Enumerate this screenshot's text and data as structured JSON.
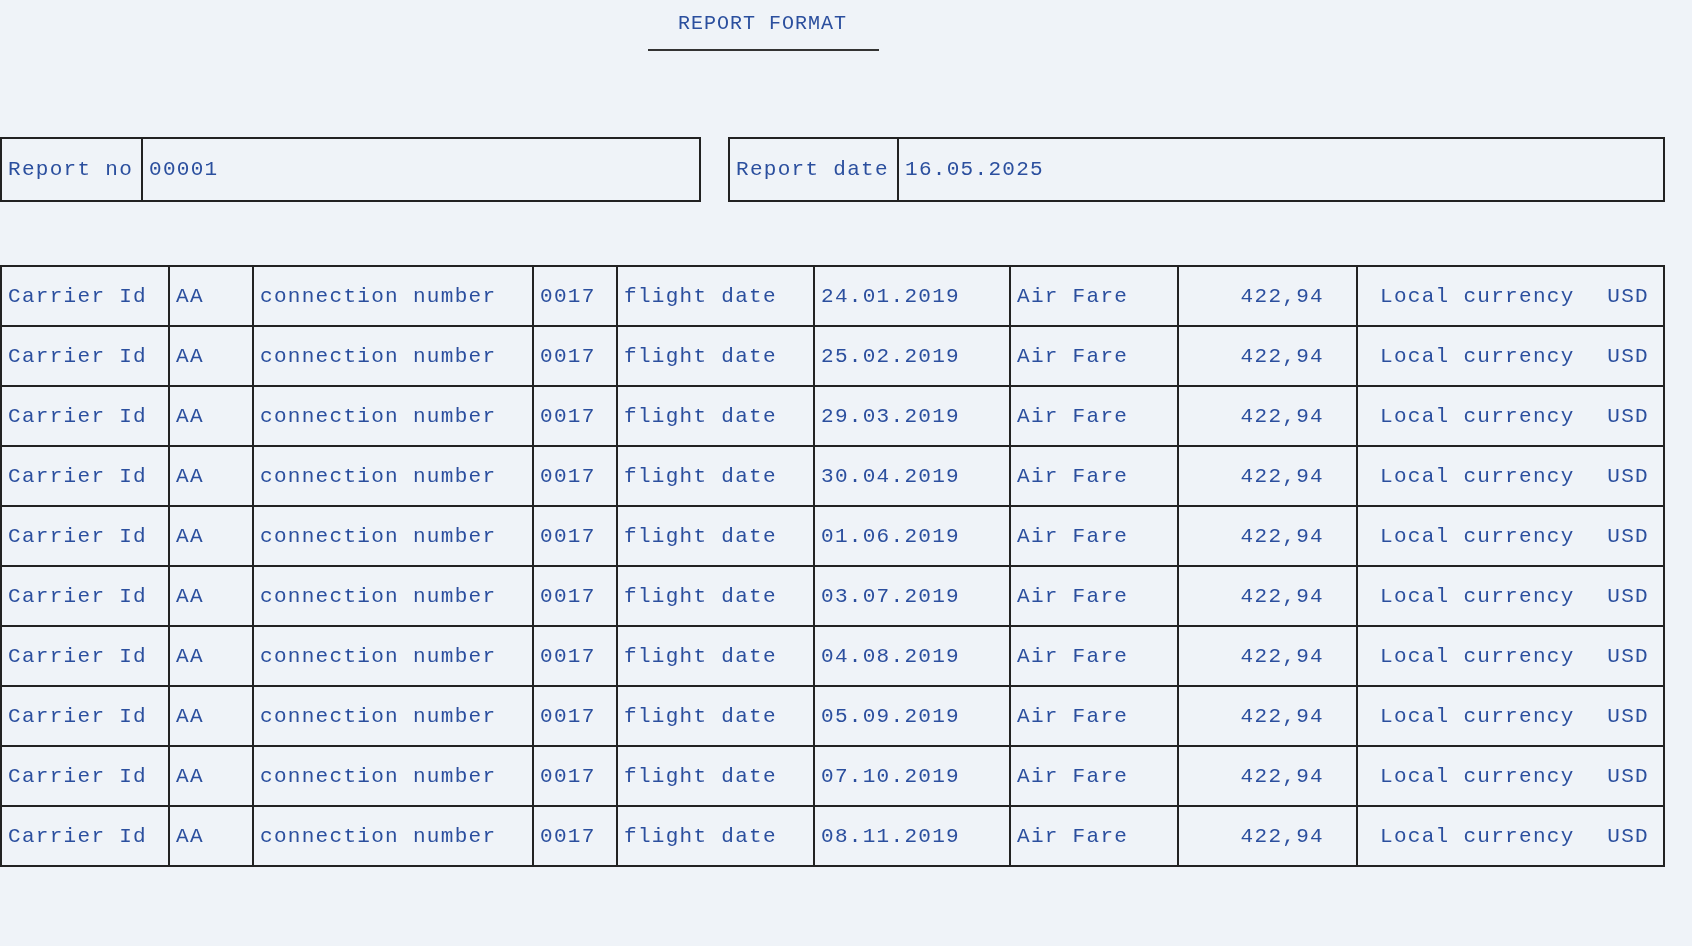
{
  "title": "REPORT FORMAT",
  "header": [
    {
      "label": "Report no",
      "value": "00001"
    },
    {
      "label": "Report date",
      "value": "16.05.2025"
    }
  ],
  "rows": [
    {
      "carrier_label": "Carrier Id",
      "carrier": "AA",
      "connection_label": "connection number",
      "connection": "0017",
      "date_label": "flight date",
      "date": "24.01.2019",
      "fare_label": "Air Fare",
      "fare": "422,94",
      "currency_label": "Local currency",
      "currency": "USD"
    },
    {
      "carrier_label": "Carrier Id",
      "carrier": "AA",
      "connection_label": "connection number",
      "connection": "0017",
      "date_label": "flight date",
      "date": "25.02.2019",
      "fare_label": "Air Fare",
      "fare": "422,94",
      "currency_label": "Local currency",
      "currency": "USD"
    },
    {
      "carrier_label": "Carrier Id",
      "carrier": "AA",
      "connection_label": "connection number",
      "connection": "0017",
      "date_label": "flight date",
      "date": "29.03.2019",
      "fare_label": "Air Fare",
      "fare": "422,94",
      "currency_label": "Local currency",
      "currency": "USD"
    },
    {
      "carrier_label": "Carrier Id",
      "carrier": "AA",
      "connection_label": "connection number",
      "connection": "0017",
      "date_label": "flight date",
      "date": "30.04.2019",
      "fare_label": "Air Fare",
      "fare": "422,94",
      "currency_label": "Local currency",
      "currency": "USD"
    },
    {
      "carrier_label": "Carrier Id",
      "carrier": "AA",
      "connection_label": "connection number",
      "connection": "0017",
      "date_label": "flight date",
      "date": "01.06.2019",
      "fare_label": "Air Fare",
      "fare": "422,94",
      "currency_label": "Local currency",
      "currency": "USD"
    },
    {
      "carrier_label": "Carrier Id",
      "carrier": "AA",
      "connection_label": "connection number",
      "connection": "0017",
      "date_label": "flight date",
      "date": "03.07.2019",
      "fare_label": "Air Fare",
      "fare": "422,94",
      "currency_label": "Local currency",
      "currency": "USD"
    },
    {
      "carrier_label": "Carrier Id",
      "carrier": "AA",
      "connection_label": "connection number",
      "connection": "0017",
      "date_label": "flight date",
      "date": "04.08.2019",
      "fare_label": "Air Fare",
      "fare": "422,94",
      "currency_label": "Local currency",
      "currency": "USD"
    },
    {
      "carrier_label": "Carrier Id",
      "carrier": "AA",
      "connection_label": "connection number",
      "connection": "0017",
      "date_label": "flight date",
      "date": "05.09.2019",
      "fare_label": "Air Fare",
      "fare": "422,94",
      "currency_label": "Local currency",
      "currency": "USD"
    },
    {
      "carrier_label": "Carrier Id",
      "carrier": "AA",
      "connection_label": "connection number",
      "connection": "0017",
      "date_label": "flight date",
      "date": "07.10.2019",
      "fare_label": "Air Fare",
      "fare": "422,94",
      "currency_label": "Local currency",
      "currency": "USD"
    },
    {
      "carrier_label": "Carrier Id",
      "carrier": "AA",
      "connection_label": "connection number",
      "connection": "0017",
      "date_label": "flight date",
      "date": "08.11.2019",
      "fare_label": "Air Fare",
      "fare": "422,94",
      "currency_label": "Local currency",
      "currency": "USD"
    }
  ]
}
